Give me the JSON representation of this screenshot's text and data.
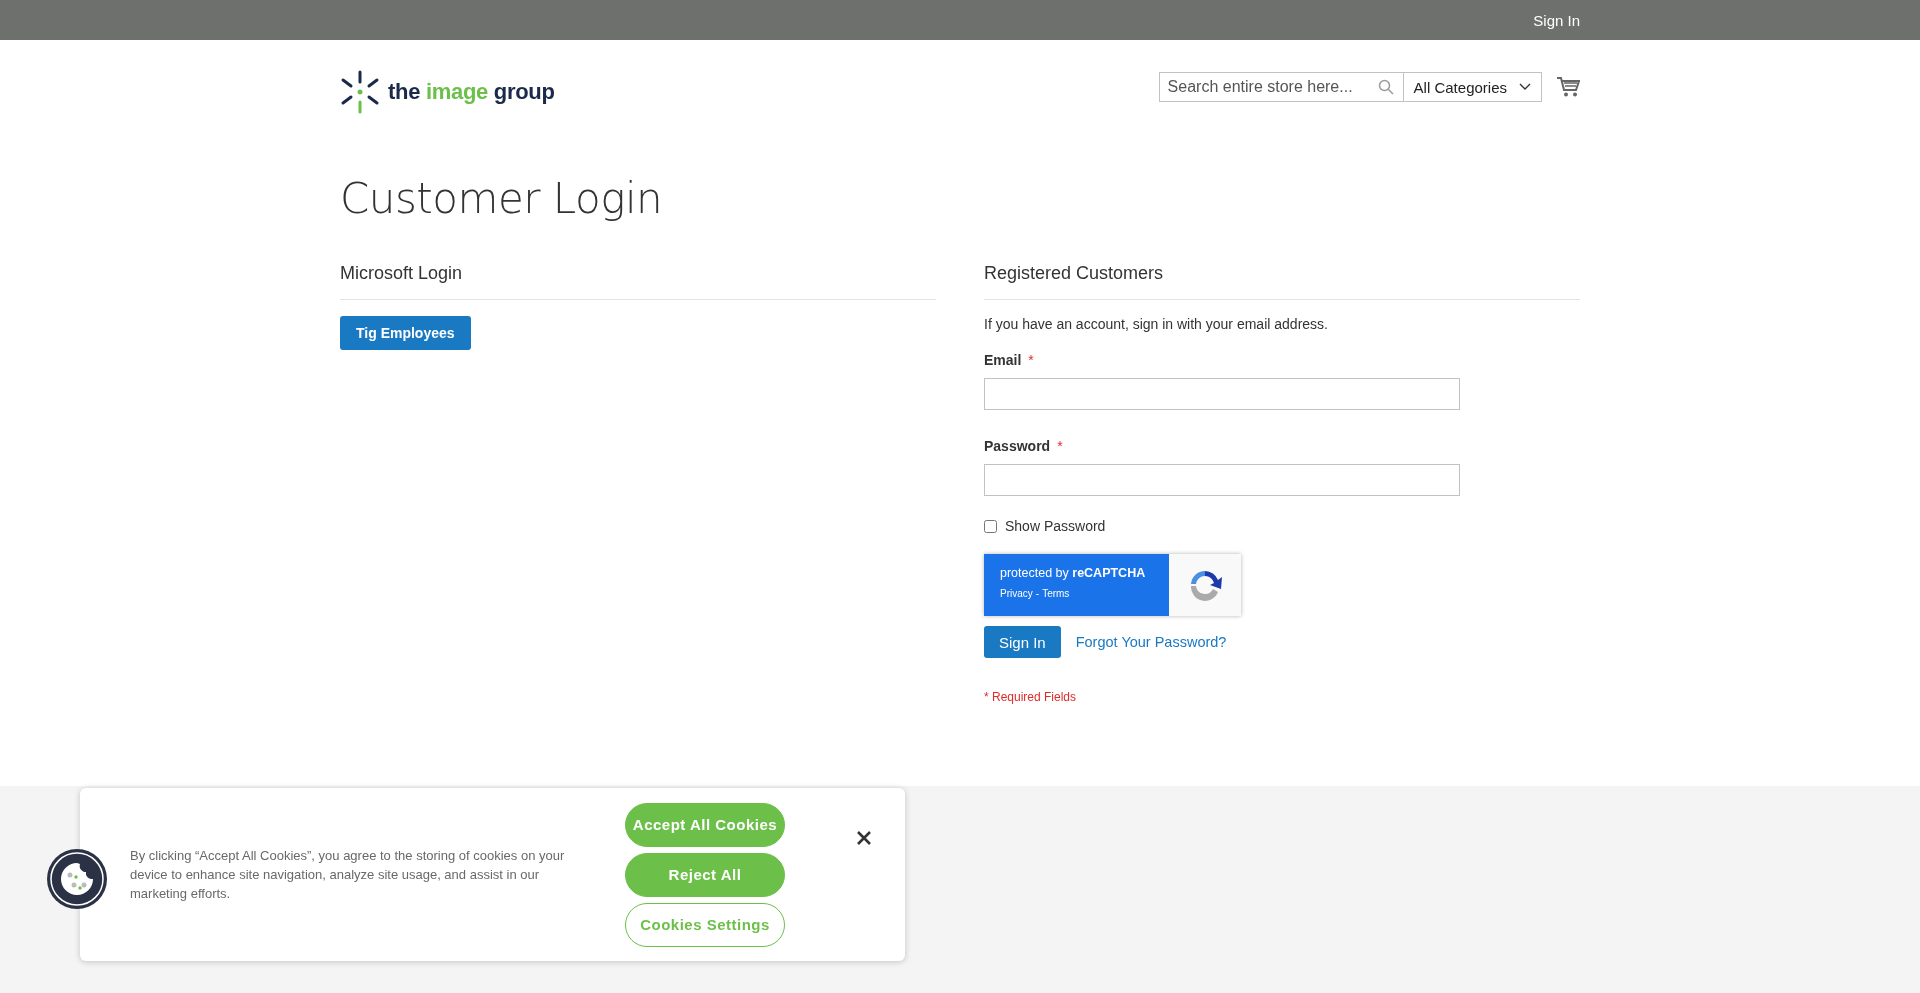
{
  "top_bar": {
    "links": [
      {
        "label": "Sign In"
      }
    ]
  },
  "header": {
    "logo": {
      "words": [
        {
          "text": "the",
          "accent": false
        },
        {
          "text": "image",
          "accent": true
        },
        {
          "text": "group",
          "accent": false
        }
      ]
    },
    "search": {
      "placeholder": "Search entire store here...",
      "category": "All Categories"
    }
  },
  "page_title": "Customer Login",
  "microsoft_login": {
    "heading": "Microsoft Login",
    "button": "Tig Employees"
  },
  "registered": {
    "heading": "Registered Customers",
    "intro": "If you have an account, sign in with your email address.",
    "fields": [
      {
        "label": "Email",
        "required_mark": "*"
      },
      {
        "label": "Password",
        "required_mark": "*"
      }
    ],
    "show_password": {
      "label": "Show Password",
      "checked": false
    },
    "recaptcha": {
      "title": "protected by **reCAPTCHA**",
      "links": [
        "Privacy",
        "Terms"
      ],
      "separator": "-"
    },
    "sign_in": "Sign In",
    "forgot": "Forgot Your Password?",
    "required_note": "* Required Fields"
  },
  "cookie_banner": {
    "text": "By clicking “Accept All Cookies”, you agree to the storing of cookies on your device to enhance site navigation, analyze site usage, and assist in our marketing efforts.",
    "buttons": [
      {
        "label": "Accept All Cookies",
        "kind": "filled"
      },
      {
        "label": "Reject All",
        "kind": "filled"
      },
      {
        "label": "Cookies Settings",
        "kind": "outline"
      }
    ]
  }
}
